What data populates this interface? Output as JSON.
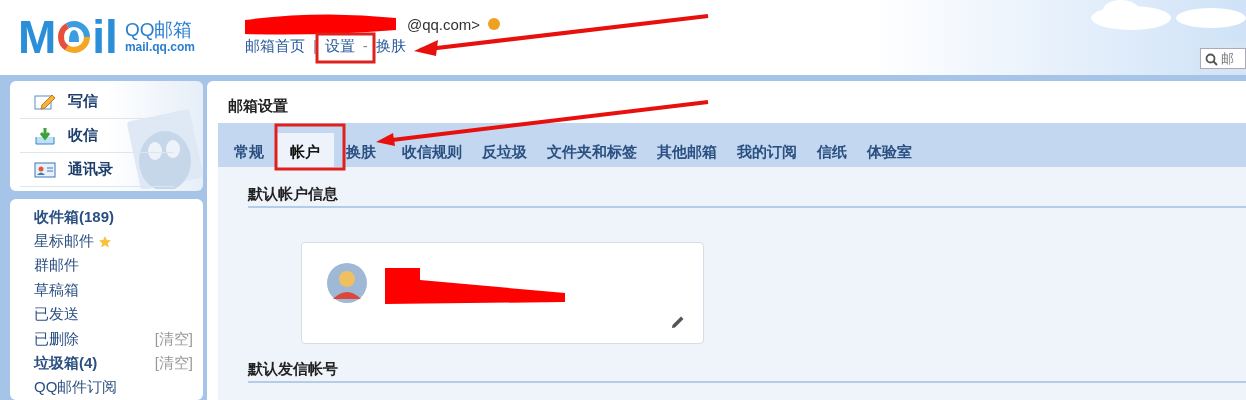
{
  "header": {
    "logo": {
      "left": "M",
      "right": "il",
      "brand": "QQ邮箱",
      "domain": "mail.qq.com"
    },
    "account": "@qq.com>",
    "nav": [
      {
        "kind": "link",
        "text": "邮箱首页"
      },
      {
        "kind": "separator",
        "text": "|"
      },
      {
        "kind": "link",
        "text": "设置"
      },
      {
        "kind": "separator",
        "text": "-"
      },
      {
        "kind": "link",
        "text": "换肤"
      }
    ],
    "search": {
      "placeholder": "邮"
    }
  },
  "sidebar": {
    "actions": [
      {
        "kind": "write",
        "label": "写信"
      },
      {
        "kind": "receive",
        "label": "收信"
      },
      {
        "kind": "contacts",
        "label": "通讯录"
      }
    ],
    "folders": [
      {
        "label": "收件箱(189)",
        "unread": true,
        "starred": false
      },
      {
        "label": "星标邮件",
        "unread": false,
        "starred": true
      },
      {
        "label": "群邮件",
        "unread": false,
        "starred": false
      },
      {
        "label": "草稿箱",
        "unread": false,
        "starred": false
      },
      {
        "label": "已发送",
        "unread": false,
        "starred": false
      },
      {
        "label": "已删除",
        "unread": false,
        "starred": false,
        "clear": "[清空]"
      },
      {
        "label": "垃圾箱(4)",
        "unread": true,
        "starred": false,
        "clear": "[清空]"
      },
      {
        "label": "QQ邮件订阅",
        "unread": false,
        "starred": false
      }
    ]
  },
  "main": {
    "title": "邮箱设置",
    "tabs": [
      {
        "label": "常规",
        "selected": false
      },
      {
        "label": "帐户",
        "selected": true
      },
      {
        "label": "换肤",
        "selected": false
      },
      {
        "label": "收信规则",
        "selected": false
      },
      {
        "label": "反垃圾",
        "selected": false
      },
      {
        "label": "文件夹和标签",
        "selected": false
      },
      {
        "label": "其他邮箱",
        "selected": false
      },
      {
        "label": "我的订阅",
        "selected": false
      },
      {
        "label": "信纸",
        "selected": false
      },
      {
        "label": "体验室",
        "selected": false
      }
    ],
    "sections": [
      {
        "title": "默认帐户信息",
        "kind": "profile"
      },
      {
        "title": "默认发信帐号",
        "kind": "plain"
      }
    ]
  }
}
